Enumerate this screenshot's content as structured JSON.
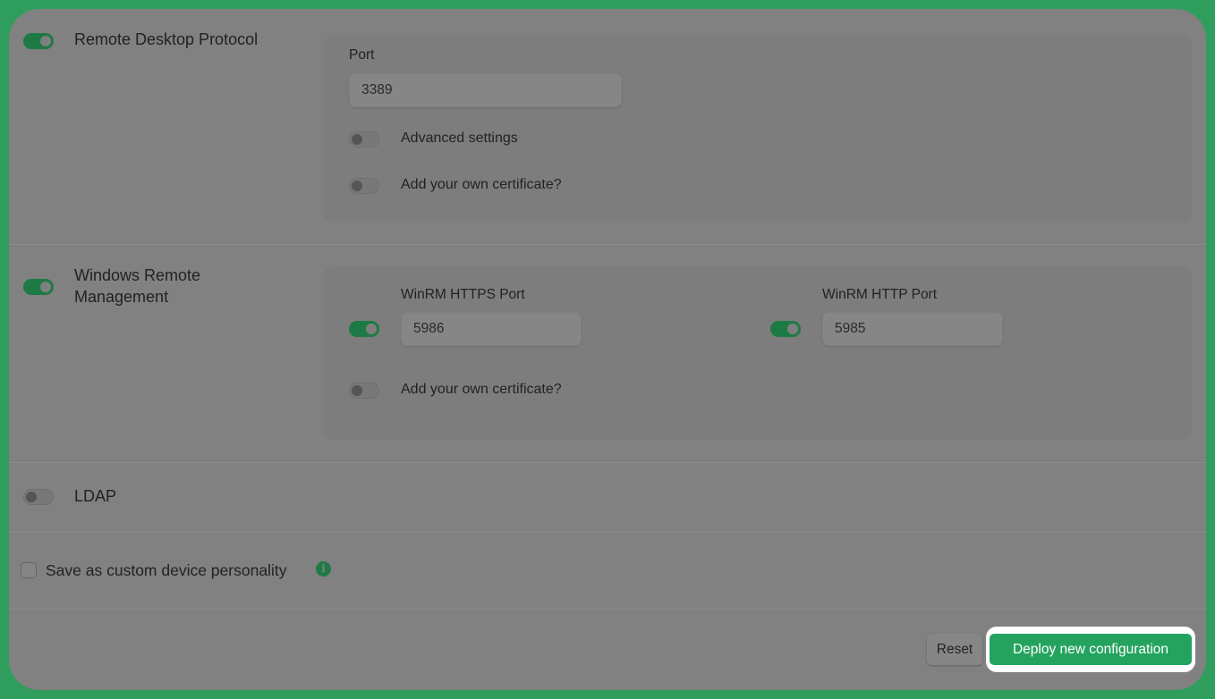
{
  "sections": {
    "rdp": {
      "label": "Remote Desktop Protocol",
      "enabled": true,
      "port_label": "Port",
      "port_value": "3389",
      "advanced_label": "Advanced settings",
      "advanced_enabled": false,
      "certificate_label": "Add your own certificate?",
      "certificate_enabled": false
    },
    "winrm": {
      "label_line1": "Windows Remote",
      "label_line2": "Management",
      "enabled": true,
      "https_port_label": "WinRM HTTPS Port",
      "https_port_value": "5986",
      "https_enabled": true,
      "http_port_label": "WinRM HTTP Port",
      "http_port_value": "5985",
      "http_enabled": true,
      "certificate_label": "Add your own certificate?",
      "certificate_enabled": false
    },
    "ldap": {
      "label": "LDAP",
      "enabled": false
    }
  },
  "custom_personality": {
    "label": "Save as custom device personality",
    "checked": false,
    "info_icon": "info-icon"
  },
  "footer": {
    "reset_label": "Reset",
    "deploy_label": "Deploy new configuration"
  },
  "colors": {
    "frame": "#2f9e5c",
    "toggle_on": "#1e7a44",
    "deploy_button": "#24a35f"
  }
}
